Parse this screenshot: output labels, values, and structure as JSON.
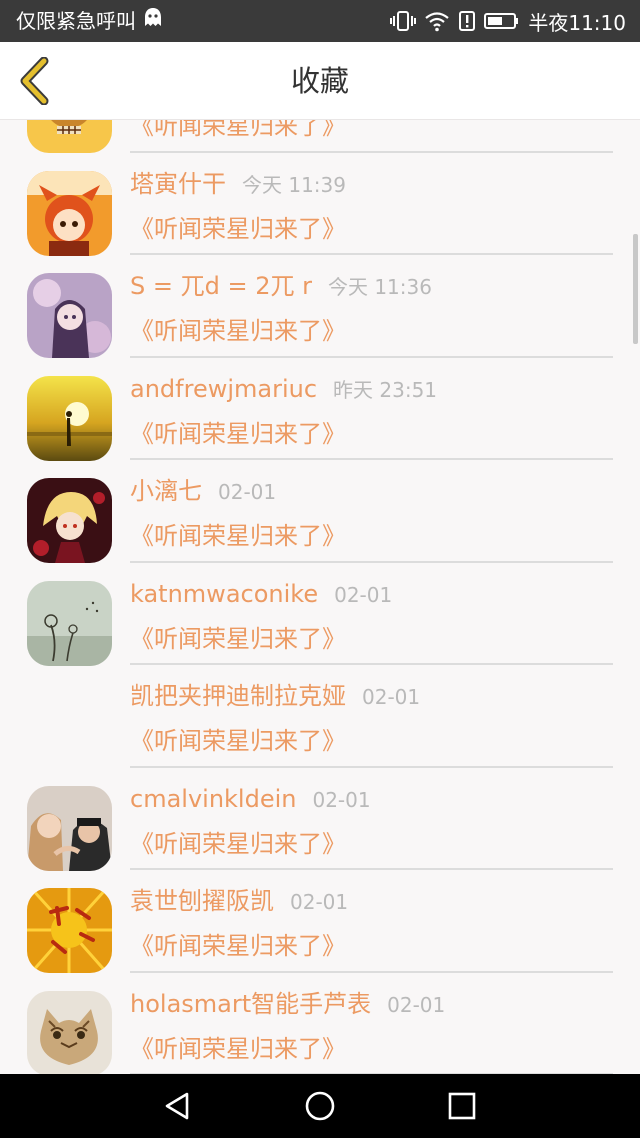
{
  "status_bar": {
    "left_text": "仅限紧急呼叫",
    "time": "半夜11:10",
    "icons": [
      "ghost-icon",
      "vibrate-icon",
      "wifi-icon",
      "alert-icon",
      "battery-icon"
    ]
  },
  "header": {
    "title": "收藏",
    "back_icon": "chevron-left-icon"
  },
  "favorites": [
    {
      "username": "",
      "timestamp": "",
      "title": "《听闻荣星归来了》",
      "avatar": "skull"
    },
    {
      "username": "塔寅什干",
      "timestamp": "今天 11:39",
      "title": "《听闻荣星归来了》",
      "avatar": "cartoon-girl"
    },
    {
      "username": "S = 兀d = 2兀 r",
      "timestamp": "今天 11:36",
      "title": "《听闻荣星归来了》",
      "avatar": "anime-purple"
    },
    {
      "username": "andfrewjmariuc",
      "timestamp": "昨天 23:51",
      "title": "《听闻荣星归来了》",
      "avatar": "sunset"
    },
    {
      "username": "小漓七",
      "timestamp": "02-01",
      "title": "《听闻荣星归来了》",
      "avatar": "anime-blond"
    },
    {
      "username": "katnmwaconike",
      "timestamp": "02-01",
      "title": "《听闻荣星归来了》",
      "avatar": "dandelion"
    },
    {
      "username": "凯把夹押迪制拉克娅",
      "timestamp": "02-01",
      "title": "《听闻荣星归来了》",
      "avatar": "none"
    },
    {
      "username": "cmalvinkldein",
      "timestamp": "02-01",
      "title": "《听闻荣星归来了》",
      "avatar": "couple"
    },
    {
      "username": "袁世刨擢阪凯",
      "timestamp": "02-01",
      "title": "《听闻荣星归来了》",
      "avatar": "new-year"
    },
    {
      "username": "holasmart智能手芦表",
      "timestamp": "02-01",
      "title": "《听闻荣星归来了》",
      "avatar": "kitten"
    }
  ],
  "nav_bar": {
    "icons": [
      "back-triangle-icon",
      "home-circle-icon",
      "recents-square-icon"
    ]
  },
  "colors": {
    "accent": "#ec9a62",
    "timestamp": "#b9b9b9",
    "divider": "#dcdcdc",
    "back_arrow": "#e4bf2e",
    "status_bar": "#3a3a3a",
    "background": "#f9f7f7"
  }
}
